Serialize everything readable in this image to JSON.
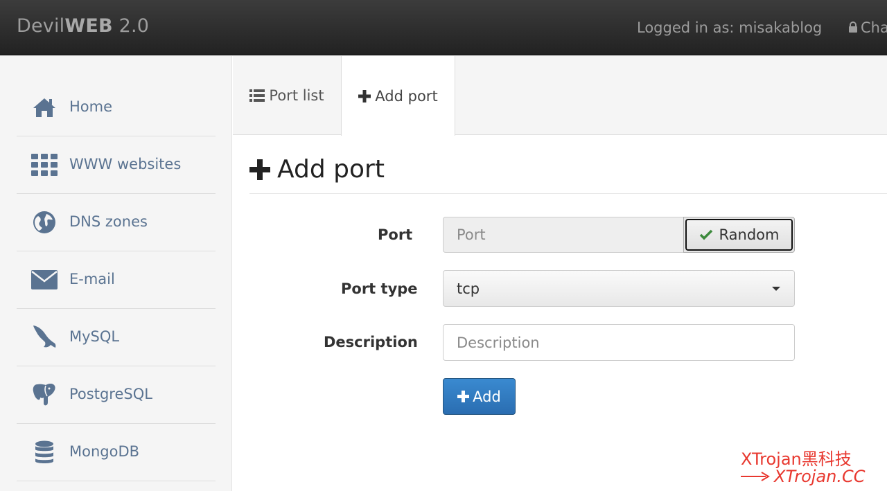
{
  "header": {
    "brand_prefix": "Devil",
    "brand_bold": "WEB",
    "brand_suffix": " 2.0",
    "logged_in": "Logged in as: misakablog",
    "change_label": "Cha"
  },
  "sidebar": {
    "items": [
      {
        "label": "Home",
        "icon": "home-icon"
      },
      {
        "label": "WWW websites",
        "icon": "grid-icon"
      },
      {
        "label": "DNS zones",
        "icon": "globe-icon"
      },
      {
        "label": "E-mail",
        "icon": "envelope-icon"
      },
      {
        "label": "MySQL",
        "icon": "dolphin-icon"
      },
      {
        "label": "PostgreSQL",
        "icon": "elephant-icon"
      },
      {
        "label": "MongoDB",
        "icon": "database-icon"
      }
    ]
  },
  "tabs": [
    {
      "label": "Port list",
      "icon": "list-icon",
      "active": false
    },
    {
      "label": "Add port",
      "icon": "plus-icon",
      "active": true
    }
  ],
  "page": {
    "title": "Add port"
  },
  "form": {
    "port_label": "Port",
    "port_placeholder": "Port",
    "random_label": "Random",
    "port_type_label": "Port type",
    "port_type_value": "tcp",
    "description_label": "Description",
    "description_placeholder": "Description",
    "add_label": "Add"
  },
  "watermark": {
    "line1": "XTrojan黑科技",
    "line2": "XTrojan.CC"
  },
  "colors": {
    "topbar": "#222222",
    "sidebar_text": "#5a7391",
    "primary_button": "#2a6db1",
    "watermark": "#e8382f"
  }
}
